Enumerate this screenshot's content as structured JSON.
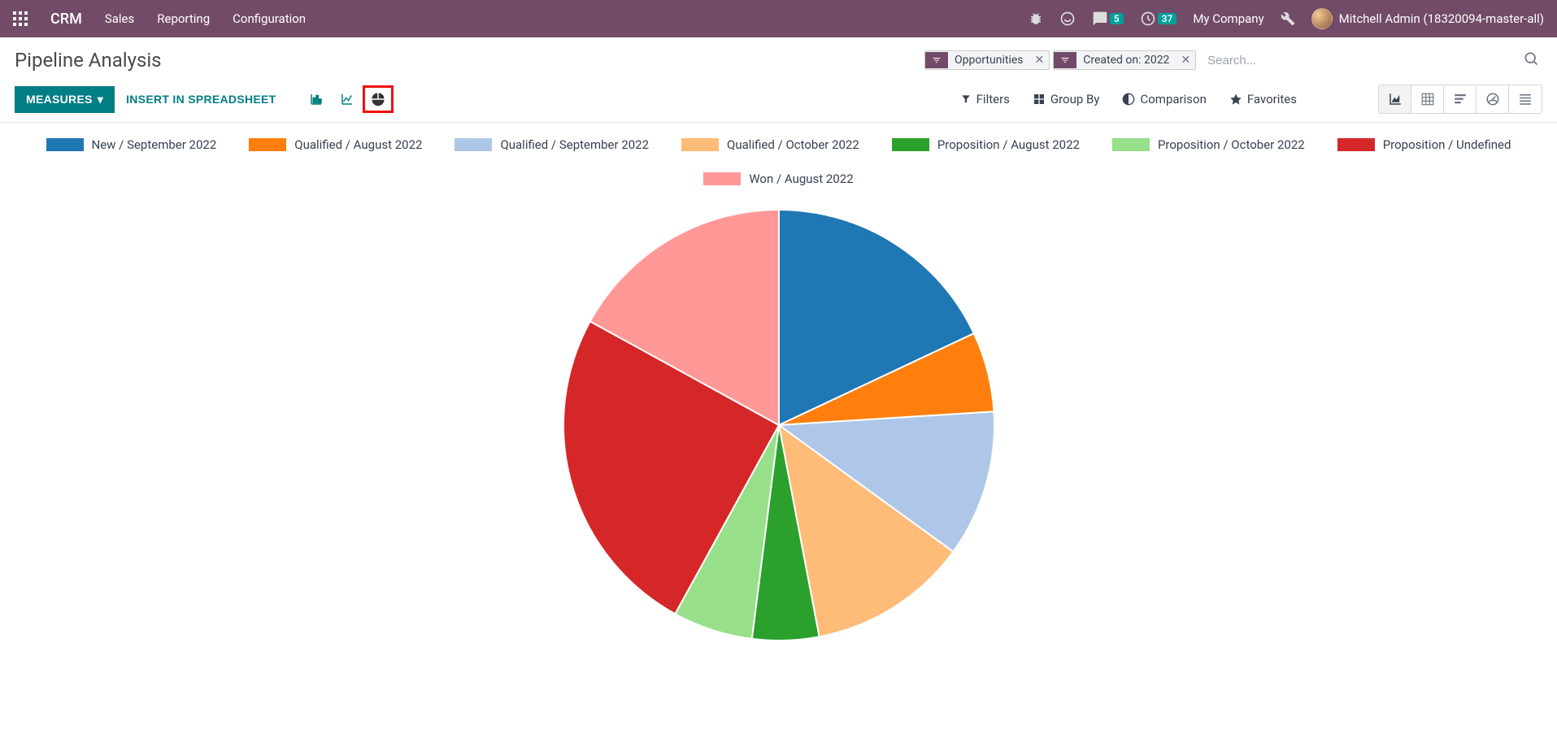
{
  "nav": {
    "app": "CRM",
    "links": [
      "Sales",
      "Reporting",
      "Configuration"
    ],
    "msg_count": "5",
    "activity_count": "37",
    "company": "My Company",
    "user": "Mitchell Admin (18320094-master-all)"
  },
  "page": {
    "title": "Pipeline Analysis",
    "measures_label": "MEASURES",
    "insert_label": "INSERT IN SPREADSHEET"
  },
  "search": {
    "facets": [
      {
        "label": "Opportunities"
      },
      {
        "label": "Created on: 2022"
      }
    ],
    "placeholder": "Search...",
    "options": {
      "filters": "Filters",
      "groupby": "Group By",
      "comparison": "Comparison",
      "favorites": "Favorites"
    }
  },
  "chart_data": {
    "type": "pie",
    "title": "",
    "series": [
      {
        "name": "New / September 2022",
        "value": 18,
        "color": "#1f77b4"
      },
      {
        "name": "Qualified / August 2022",
        "value": 6,
        "color": "#ff7f0e"
      },
      {
        "name": "Qualified / September 2022",
        "value": 11,
        "color": "#aec7e8"
      },
      {
        "name": "Qualified / October 2022",
        "value": 12,
        "color": "#ffbb78"
      },
      {
        "name": "Proposition / August 2022",
        "value": 5,
        "color": "#2ca02c"
      },
      {
        "name": "Proposition / October 2022",
        "value": 6,
        "color": "#98df8a"
      },
      {
        "name": "Proposition / Undefined",
        "value": 25,
        "color": "#d62728"
      },
      {
        "name": "Won / August 2022",
        "value": 17,
        "color": "#ff9896"
      }
    ]
  }
}
